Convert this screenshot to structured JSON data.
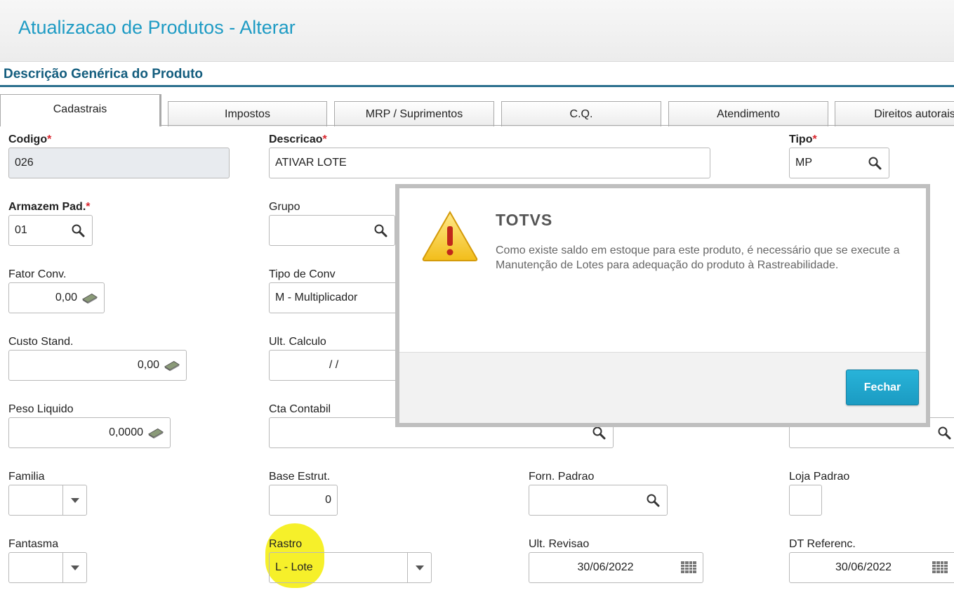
{
  "header": {
    "title": "Atualizacao de Produtos - Alterar"
  },
  "section": {
    "title": "Descrição Genérica do Produto"
  },
  "tabs": [
    {
      "label": "Cadastrais",
      "active": true
    },
    {
      "label": "Impostos"
    },
    {
      "label": "MRP / Suprimentos"
    },
    {
      "label": "C.Q."
    },
    {
      "label": "Atendimento"
    },
    {
      "label": "Direitos autorais"
    }
  ],
  "form": {
    "codigo": {
      "label": "Codigo",
      "value": "026"
    },
    "descricao": {
      "label": "Descricao",
      "value": "ATIVAR LOTE"
    },
    "tipo": {
      "label": "Tipo",
      "value": "MP"
    },
    "armazem": {
      "label": "Armazem Pad.",
      "value": "01"
    },
    "grupo": {
      "label": "Grupo",
      "value": ""
    },
    "fator_conv": {
      "label": "Fator Conv.",
      "value": "0,00"
    },
    "tipo_conv": {
      "label": "Tipo de Conv",
      "value": "M - Multiplicador"
    },
    "custo_stand": {
      "label": "Custo Stand.",
      "value": "0,00"
    },
    "ult_calculo": {
      "label": "Ult. Calculo",
      "value": "/ /"
    },
    "peso_liquido": {
      "label": "Peso Liquido",
      "value": "0,0000"
    },
    "cta_contabil": {
      "label": "Cta Contabil",
      "value": ""
    },
    "familia": {
      "label": "Familia",
      "value": ""
    },
    "base_estrut": {
      "label": "Base Estrut.",
      "value": "0"
    },
    "forn_padrao": {
      "label": "Forn. Padrao",
      "value": ""
    },
    "loja_padrao": {
      "label": "Loja Padrao",
      "value": ""
    },
    "fantasma": {
      "label": "Fantasma",
      "value": ""
    },
    "rastro": {
      "label": "Rastro",
      "value": "L - Lote"
    },
    "ult_revisao": {
      "label": "Ult. Revisao",
      "value": "30/06/2022"
    },
    "dt_referenc": {
      "label": "DT Referenc.",
      "value": "30/06/2022"
    },
    "required_marker": "*"
  },
  "dialog": {
    "title": "TOTVS",
    "message": "Como existe saldo em estoque para este produto, é necessário que se execute a Manutenção de Lotes para adequação do produto à Rastreabilidade.",
    "close_label": "Fechar"
  },
  "colors": {
    "accent": "#1e9bc4",
    "section_title": "#135d7e",
    "required": "#d9242c",
    "highlight": "#f6f02a"
  }
}
